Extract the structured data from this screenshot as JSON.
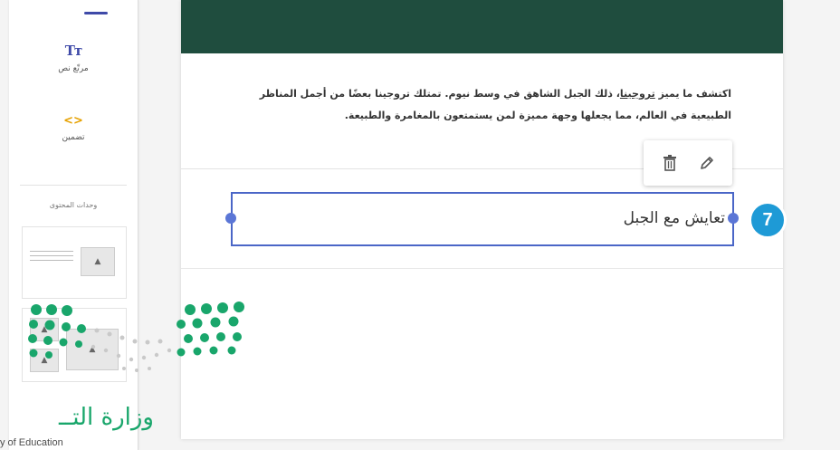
{
  "sidebar": {
    "tools": [
      {
        "label": "مرتّع نص",
        "icon": "text-format-icon",
        "glyph": "Tт"
      },
      {
        "label": "تضمين",
        "icon": "embed-code-icon",
        "glyph": "<>"
      }
    ],
    "section_title": "وحدات المحتوى"
  },
  "main": {
    "paragraph_before": "اكتشف ما يميز ",
    "paragraph_link": "تروجينا",
    "paragraph_after": "، ذلك الجبل الشاهق في وسط نيوم. تمتلك تروجينا بعضًا من أجمل المناظر الطبيعية في العالم، مما يجعلها وجهة مميزة لمن يستمتعون بالمغامرة والطبيعة.",
    "title_value": "تعايش مع الجبل"
  },
  "toolbar": {
    "delete_icon": "trash-icon",
    "edit_icon": "pencil-icon"
  },
  "annotation": {
    "step_number": "7",
    "color": "#1e9ad6"
  },
  "watermark": {
    "ministry_ar": "وزارة التــ",
    "ministry_en": "y of Education"
  },
  "colors": {
    "header": "#1f4d3e",
    "selection": "#4a66c7",
    "accent_blue": "#3f4aa8",
    "accent_orange": "#e6a100",
    "logo_green": "#19a66b"
  }
}
